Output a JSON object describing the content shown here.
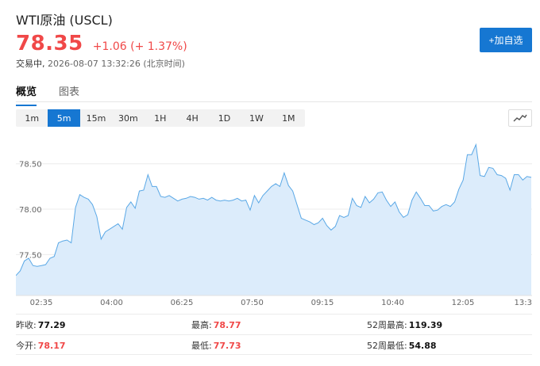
{
  "header": {
    "title": "WTI原油 (USCL)",
    "price": "78.35",
    "change": "+1.06 (+ 1.37%)",
    "status": "交易中,",
    "timestamp": "2026-08-07 13:32:26 (北京时间)",
    "add_button": "+加自选"
  },
  "tabs": [
    {
      "label": "概览",
      "active": true
    },
    {
      "label": "图表",
      "active": false
    }
  ],
  "intervals": [
    "1m",
    "5m",
    "15m",
    "30m",
    "1H",
    "4H",
    "1D",
    "1W",
    "1M"
  ],
  "active_interval": "5m",
  "icons": {
    "chart_toggle": "line-chart-icon"
  },
  "colors": {
    "up": "#f04848",
    "accent": "#1677d2",
    "line": "#5aa8e6",
    "fill": "#dcecfb"
  },
  "chart_data": {
    "type": "area",
    "x_ticks": [
      "02:35",
      "04:00",
      "06:25",
      "07:50",
      "09:15",
      "10:40",
      "12:05",
      "13:3"
    ],
    "y_ticks": [
      "78.50",
      "78.00",
      "77.50"
    ],
    "ylim": [
      77.05,
      78.82
    ],
    "grid": true,
    "values": [
      77.27,
      77.32,
      77.43,
      77.46,
      77.38,
      77.37,
      77.38,
      77.39,
      77.46,
      77.48,
      77.63,
      77.65,
      77.66,
      77.63,
      78.02,
      78.16,
      78.13,
      78.11,
      78.05,
      77.92,
      77.67,
      77.75,
      77.78,
      77.81,
      77.84,
      77.78,
      78.02,
      78.08,
      78.01,
      78.2,
      78.21,
      78.38,
      78.25,
      78.25,
      78.14,
      78.13,
      78.15,
      78.12,
      78.09,
      78.11,
      78.12,
      78.14,
      78.13,
      78.11,
      78.12,
      78.1,
      78.13,
      78.1,
      78.09,
      78.1,
      78.09,
      78.1,
      78.12,
      78.09,
      78.1,
      77.99,
      78.15,
      78.07,
      78.15,
      78.2,
      78.25,
      78.28,
      78.25,
      78.4,
      78.26,
      78.2,
      78.05,
      77.9,
      77.88,
      77.86,
      77.83,
      77.85,
      77.9,
      77.82,
      77.77,
      77.81,
      77.93,
      77.91,
      77.93,
      78.12,
      78.04,
      78.02,
      78.14,
      78.07,
      78.11,
      78.18,
      78.19,
      78.1,
      78.03,
      78.08,
      77.97,
      77.91,
      77.94,
      78.1,
      78.19,
      78.12,
      78.04,
      78.04,
      77.98,
      77.99,
      78.03,
      78.05,
      78.03,
      78.08,
      78.22,
      78.32,
      78.6,
      78.6,
      78.71,
      78.37,
      78.36,
      78.46,
      78.45,
      78.38,
      78.37,
      78.34,
      78.21,
      78.38,
      78.38,
      78.32,
      78.36,
      78.35
    ]
  },
  "stats": {
    "prev_close_label": "昨收:",
    "prev_close": "77.29",
    "open_label": "今开:",
    "open": "78.17",
    "high_label": "最高:",
    "high": "78.77",
    "low_label": "最低:",
    "low": "77.73",
    "w52_high_label": "52周最高:",
    "w52_high": "119.39",
    "w52_low_label": "52周最低:",
    "w52_low": "54.88"
  }
}
